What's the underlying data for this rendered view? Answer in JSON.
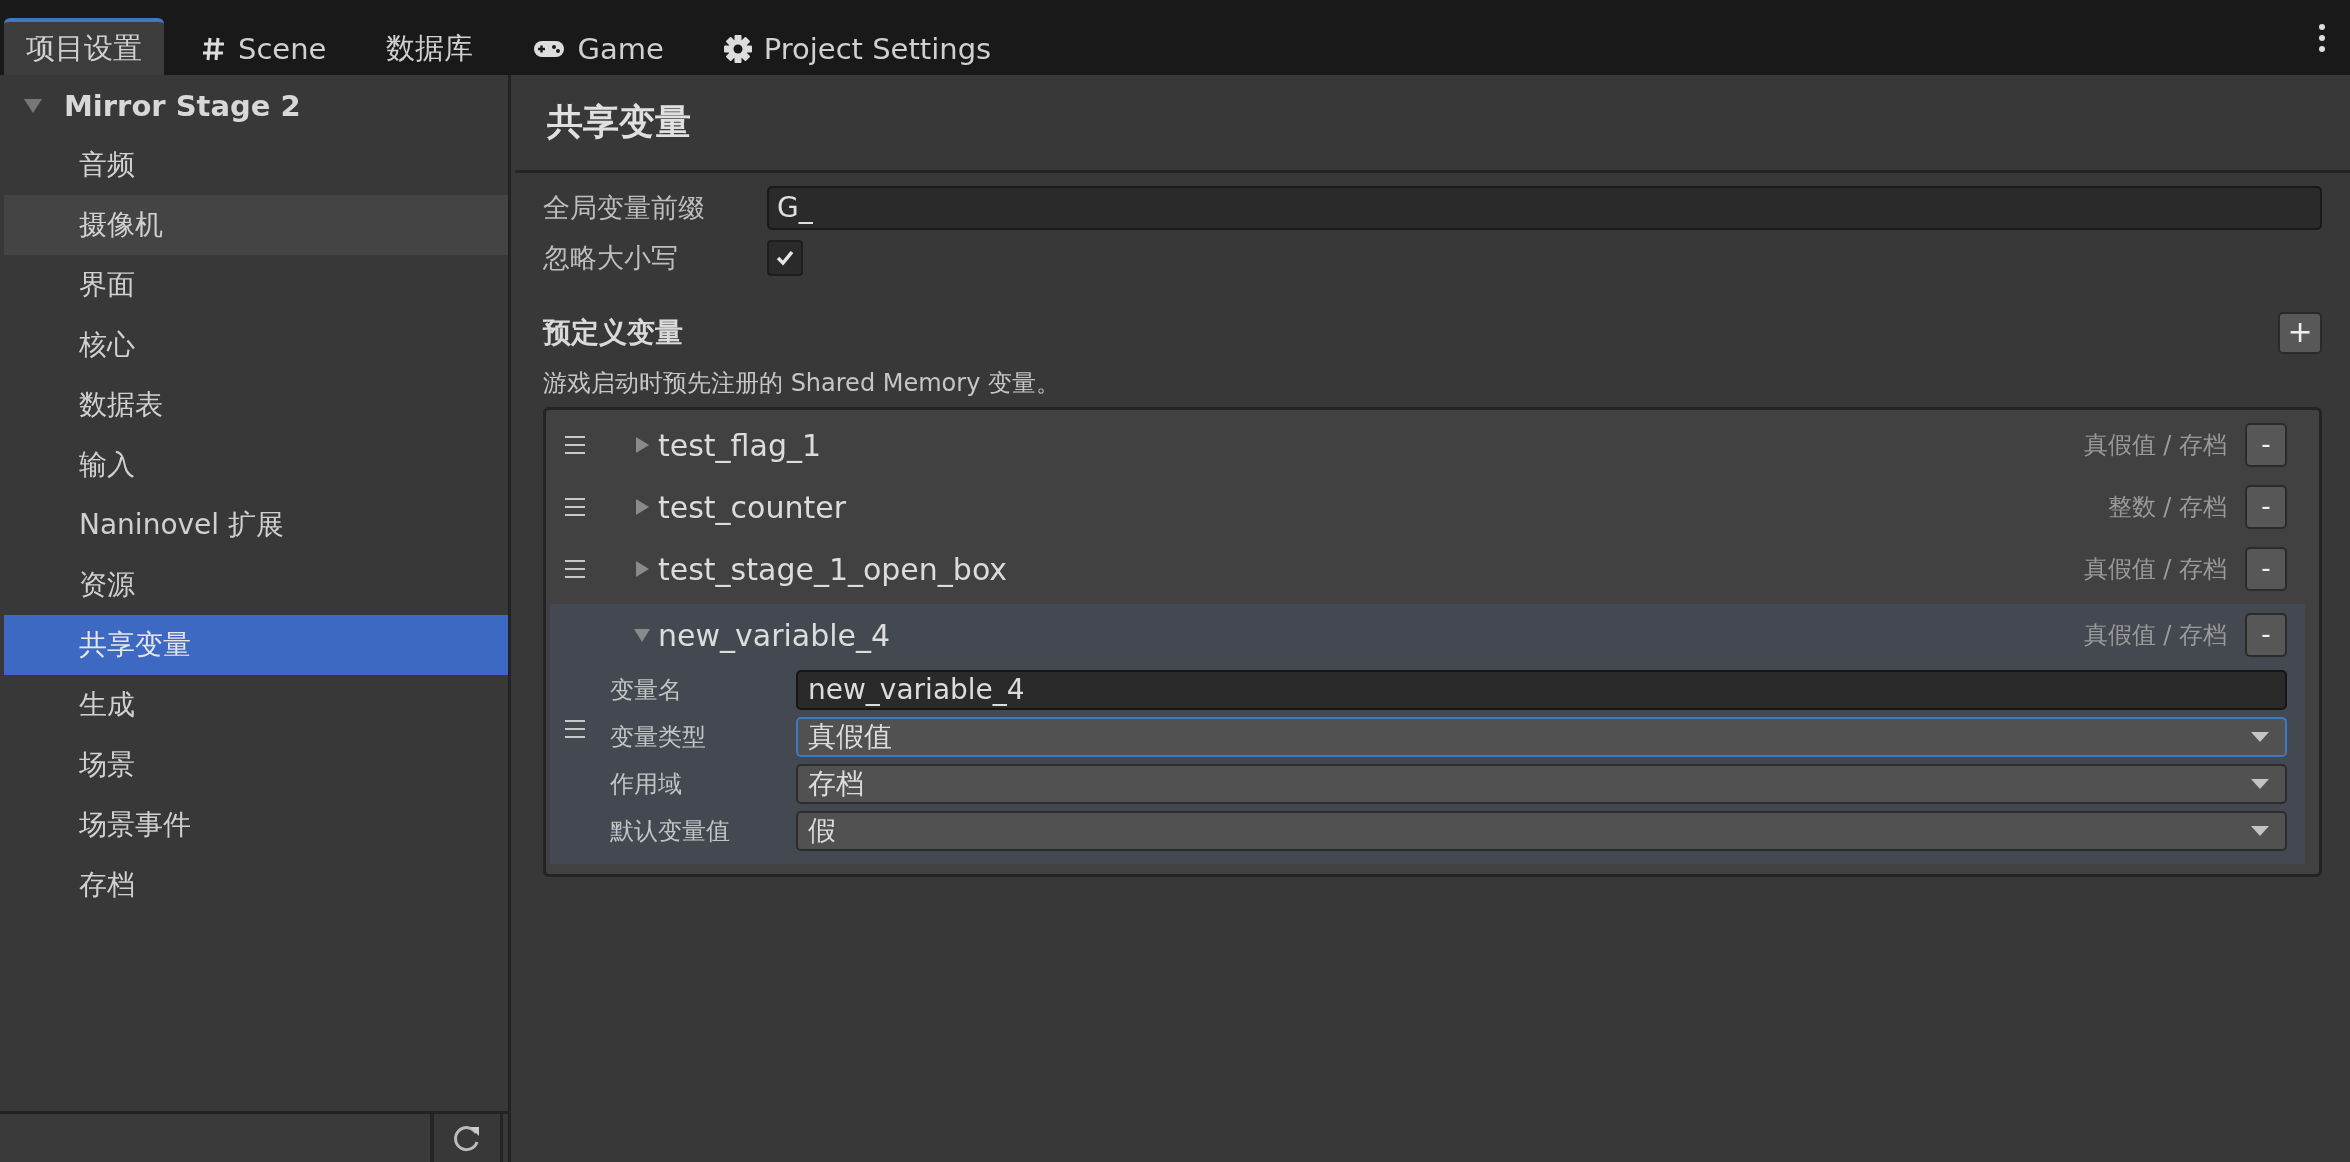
{
  "tabs": [
    {
      "label": "项目设置",
      "kind": "plain",
      "selected": true
    },
    {
      "label": "Scene",
      "kind": "scene",
      "selected": false
    },
    {
      "label": "数据库",
      "kind": "plain",
      "selected": false
    },
    {
      "label": "Game",
      "kind": "game",
      "selected": false
    },
    {
      "label": "Project Settings",
      "kind": "settings",
      "selected": false
    }
  ],
  "sidebar": {
    "root": {
      "label": "Mirror Stage 2",
      "expanded": true
    },
    "items": [
      {
        "label": "音频",
        "selected": false,
        "hovered": false
      },
      {
        "label": "摄像机",
        "selected": false,
        "hovered": true
      },
      {
        "label": "界面",
        "selected": false,
        "hovered": false
      },
      {
        "label": "核心",
        "selected": false,
        "hovered": false
      },
      {
        "label": "数据表",
        "selected": false,
        "hovered": false
      },
      {
        "label": "输入",
        "selected": false,
        "hovered": false
      },
      {
        "label": "Naninovel 扩展",
        "selected": false,
        "hovered": false
      },
      {
        "label": "资源",
        "selected": false,
        "hovered": false
      },
      {
        "label": "共享变量",
        "selected": true,
        "hovered": false
      },
      {
        "label": "生成",
        "selected": false,
        "hovered": false
      },
      {
        "label": "场景",
        "selected": false,
        "hovered": false
      },
      {
        "label": "场景事件",
        "selected": false,
        "hovered": false
      },
      {
        "label": "存档",
        "selected": false,
        "hovered": false
      }
    ]
  },
  "main": {
    "title": "共享变量",
    "prefix": {
      "label": "全局变量前缀",
      "value": "G_"
    },
    "ignore_case": {
      "label": "忽略大小写",
      "checked": true
    },
    "section": {
      "title": "预定义变量",
      "add": "+",
      "description": "游戏启动时预先注册的 Shared Memory 变量。"
    },
    "variables": [
      {
        "name": "test_flag_1",
        "summary": "真假值 / 存档",
        "remove": "-",
        "expanded": false
      },
      {
        "name": "test_counter",
        "summary": "整数 / 存档",
        "remove": "-",
        "expanded": false
      },
      {
        "name": "test_stage_1_open_box",
        "summary": "真假值 / 存档",
        "remove": "-",
        "expanded": false
      },
      {
        "name": "new_variable_4",
        "summary": "真假值 / 存档",
        "remove": "-",
        "expanded": true,
        "fields": [
          {
            "label": "变量名",
            "kind": "text",
            "value": "new_variable_4",
            "focused": false
          },
          {
            "label": "变量类型",
            "kind": "dropdown",
            "value": "真假值",
            "focused": true
          },
          {
            "label": "作用域",
            "kind": "dropdown",
            "value": "存档",
            "focused": false
          },
          {
            "label": "默认变量值",
            "kind": "dropdown",
            "value": "假",
            "focused": false
          }
        ]
      }
    ]
  }
}
